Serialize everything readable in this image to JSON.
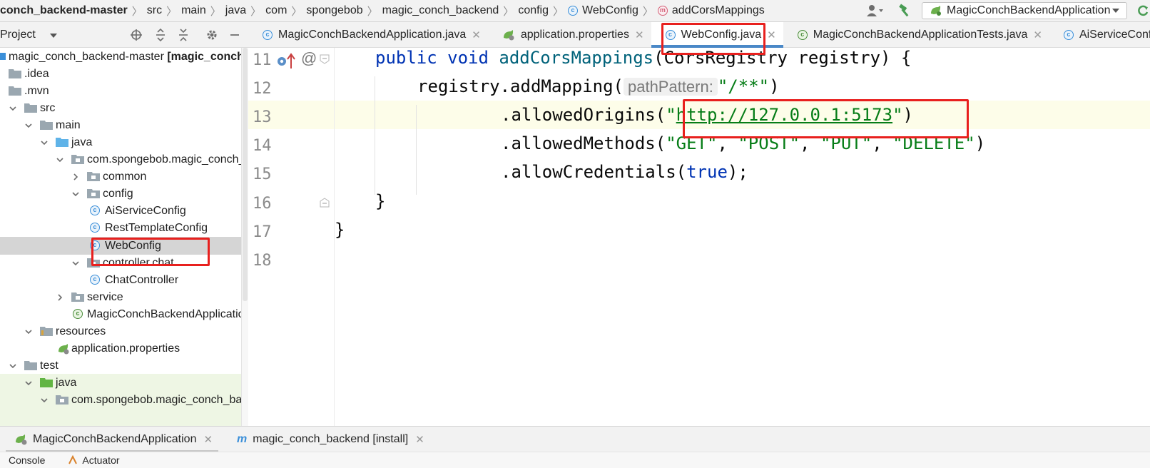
{
  "breadcrumb": {
    "items": [
      "conch_backend-master",
      "src",
      "main",
      "java",
      "com",
      "spongebob",
      "magic_conch_backend",
      "config",
      "WebConfig",
      "addCorsMappings"
    ]
  },
  "toolbar": {
    "run_config_label": "MagicConchBackendApplication"
  },
  "project_panel": {
    "title": "Project"
  },
  "tree": {
    "root_name": "magic_conch_backend-master",
    "root_module": "[magic_conch_",
    "idea": ".idea",
    "mvn": ".mvn",
    "src": "src",
    "main": "main",
    "java": "java",
    "package": "com.spongebob.magic_conch_ba",
    "common": "common",
    "config": "config",
    "ai_service_config": "AiServiceConfig",
    "rest_template_config": "RestTemplateConfig",
    "web_config": "WebConfig",
    "controller_chat": "controller.chat",
    "chat_controller": "ChatController",
    "service": "service",
    "app_class": "MagicConchBackendApplicatio",
    "resources": "resources",
    "app_properties": "application.properties",
    "test": "test",
    "test_java": "java",
    "test_package": "com.spongebob.magic_conch_ba"
  },
  "tabs": [
    {
      "label": "MagicConchBackendApplication.java"
    },
    {
      "label": "application.properties"
    },
    {
      "label": "WebConfig.java"
    },
    {
      "label": "MagicConchBackendApplicationTests.java"
    },
    {
      "label": "AiServiceConfig.ja"
    }
  ],
  "editor": {
    "line_numbers": [
      "11",
      "12",
      "13",
      "14",
      "15",
      "16",
      "17",
      "18"
    ],
    "gutter_at": "@",
    "l11_kw": "public void ",
    "l11_fn": "addCorsMappings",
    "l11_rest": "(CorsRegistry registry) {",
    "l12_a": "registry.addMapping(",
    "l12_hint": "pathPattern:",
    "l12_str": "\"/**\"",
    "l12_end": ")",
    "l13_a": ".allowedOrigins(",
    "l13_q1": "\"",
    "l13_url": "http://127.0.0.1:5173",
    "l13_q2": "\"",
    "l13_end": ")",
    "l14_a": ".allowedMethods(",
    "l14_s1": "\"GET\"",
    "l14_s2": "\"POST\"",
    "l14_s3": "\"PUT\"",
    "l14_s4": "\"DELETE\"",
    "l14_comma": ", ",
    "l14_end": ")",
    "l15_a": ".allowCredentials(",
    "l15_kw": "true",
    "l15_end": ");",
    "l16": "}",
    "l17": "}"
  },
  "run_bar": {
    "tabs": [
      "MagicConchBackendApplication",
      "magic_conch_backend [install]"
    ]
  },
  "tool_windows": {
    "tabs": [
      "Console",
      "Actuator"
    ]
  },
  "colors": {
    "highlight_box": "#e8201e",
    "active_tab_underline": "#4a88c7",
    "keyword": "#0033b3",
    "string": "#067d17"
  }
}
